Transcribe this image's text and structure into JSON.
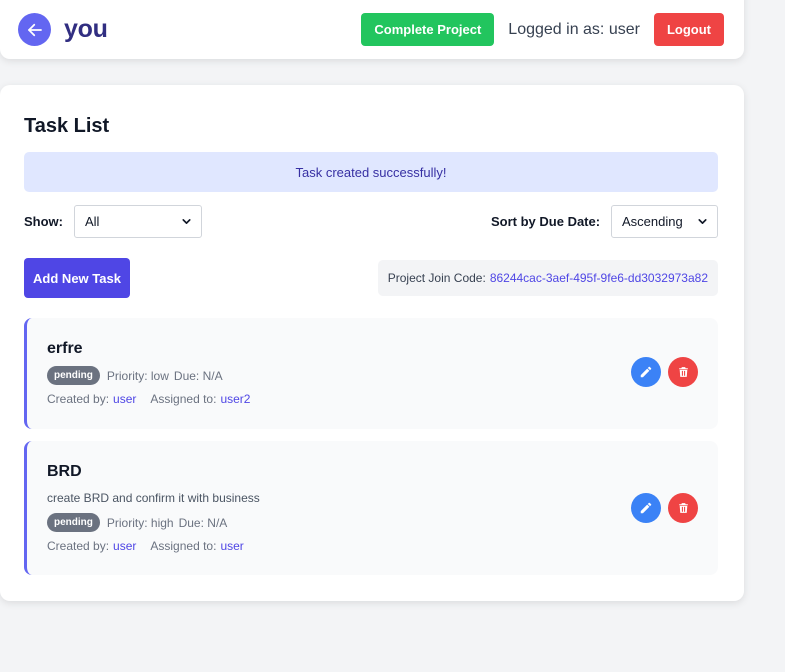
{
  "header": {
    "back_icon": "arrow-left-icon",
    "project_name": "you",
    "complete_label": "Complete Project",
    "logged_in_text": "Logged in as: user",
    "logout_label": "Logout"
  },
  "main": {
    "title": "Task List",
    "success_message": "Task created successfully!",
    "filters": {
      "show_label": "Show:",
      "show_value": "All",
      "sort_label": "Sort by Due Date:",
      "sort_value": "Ascending"
    },
    "add_task_label": "Add New Task",
    "join_code_label": "Project Join Code:",
    "join_code_value": "86244cac-3aef-495f-9fe6-dd3032973a82"
  },
  "tasks": [
    {
      "title": "erfre",
      "description": "",
      "status": "pending",
      "priority": "Priority: low",
      "due": "Due: N/A",
      "created_label": "Created by:",
      "created_by": "user",
      "assigned_label": "Assigned to:",
      "assigned_to": "user2"
    },
    {
      "title": "BRD",
      "description": "create BRD and confirm it with business",
      "status": "pending",
      "priority": "Priority: high",
      "due": "Due: N/A",
      "created_label": "Created by:",
      "created_by": "user",
      "assigned_label": "Assigned to:",
      "assigned_to": "user"
    }
  ],
  "colors": {
    "accent": "#4f46e5",
    "success": "#22c55e",
    "danger": "#ef4444",
    "edit": "#3b82f6"
  }
}
